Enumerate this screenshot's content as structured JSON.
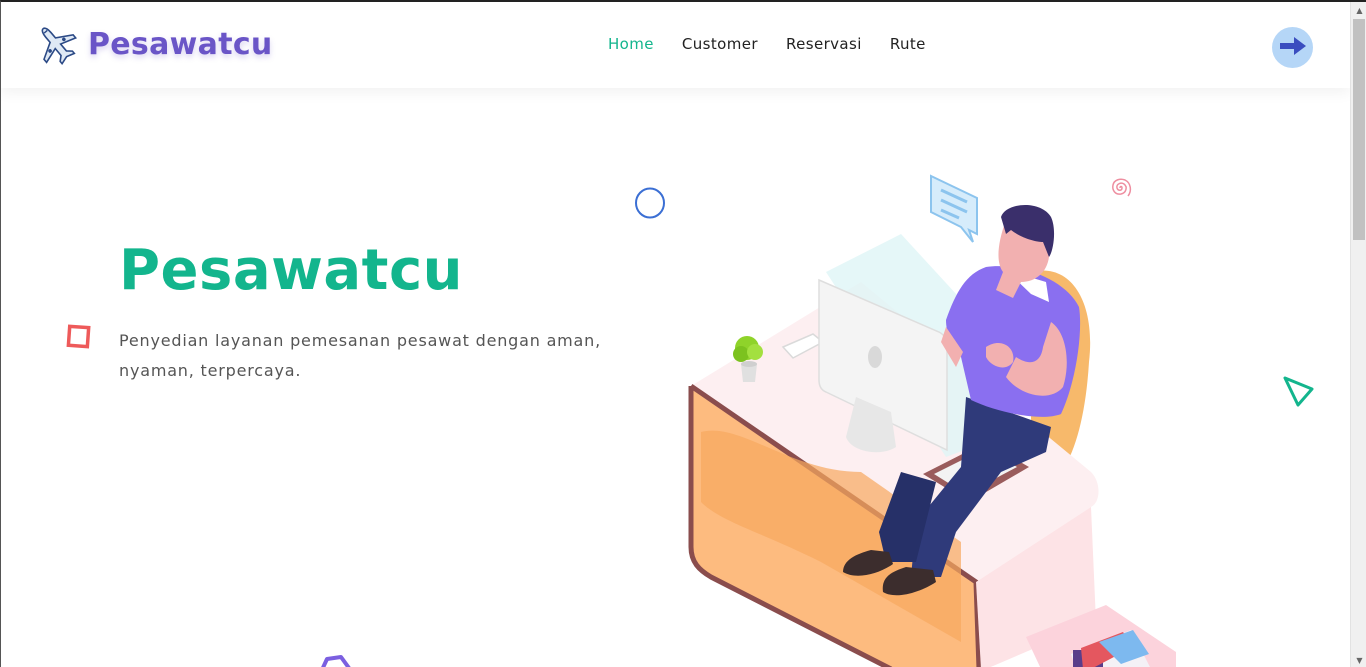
{
  "brand": {
    "name": "Pesawatcu",
    "logo_icon": "airplane-icon"
  },
  "nav": {
    "items": [
      {
        "label": "Home",
        "active": true
      },
      {
        "label": "Customer",
        "active": false
      },
      {
        "label": "Reservasi",
        "active": false
      },
      {
        "label": "Rute",
        "active": false
      }
    ]
  },
  "header": {
    "login_icon": "arrow-right-icon"
  },
  "hero": {
    "title": "Pesawatcu",
    "description": "Penyedian layanan pemesanan pesawat dengan aman, nyaman, terpercaya."
  },
  "colors": {
    "brand_purple": "#6a55c7",
    "accent_green": "#13b58d",
    "button_blue": "#b5d6f7",
    "arrow_navy": "#3a4dbf"
  }
}
